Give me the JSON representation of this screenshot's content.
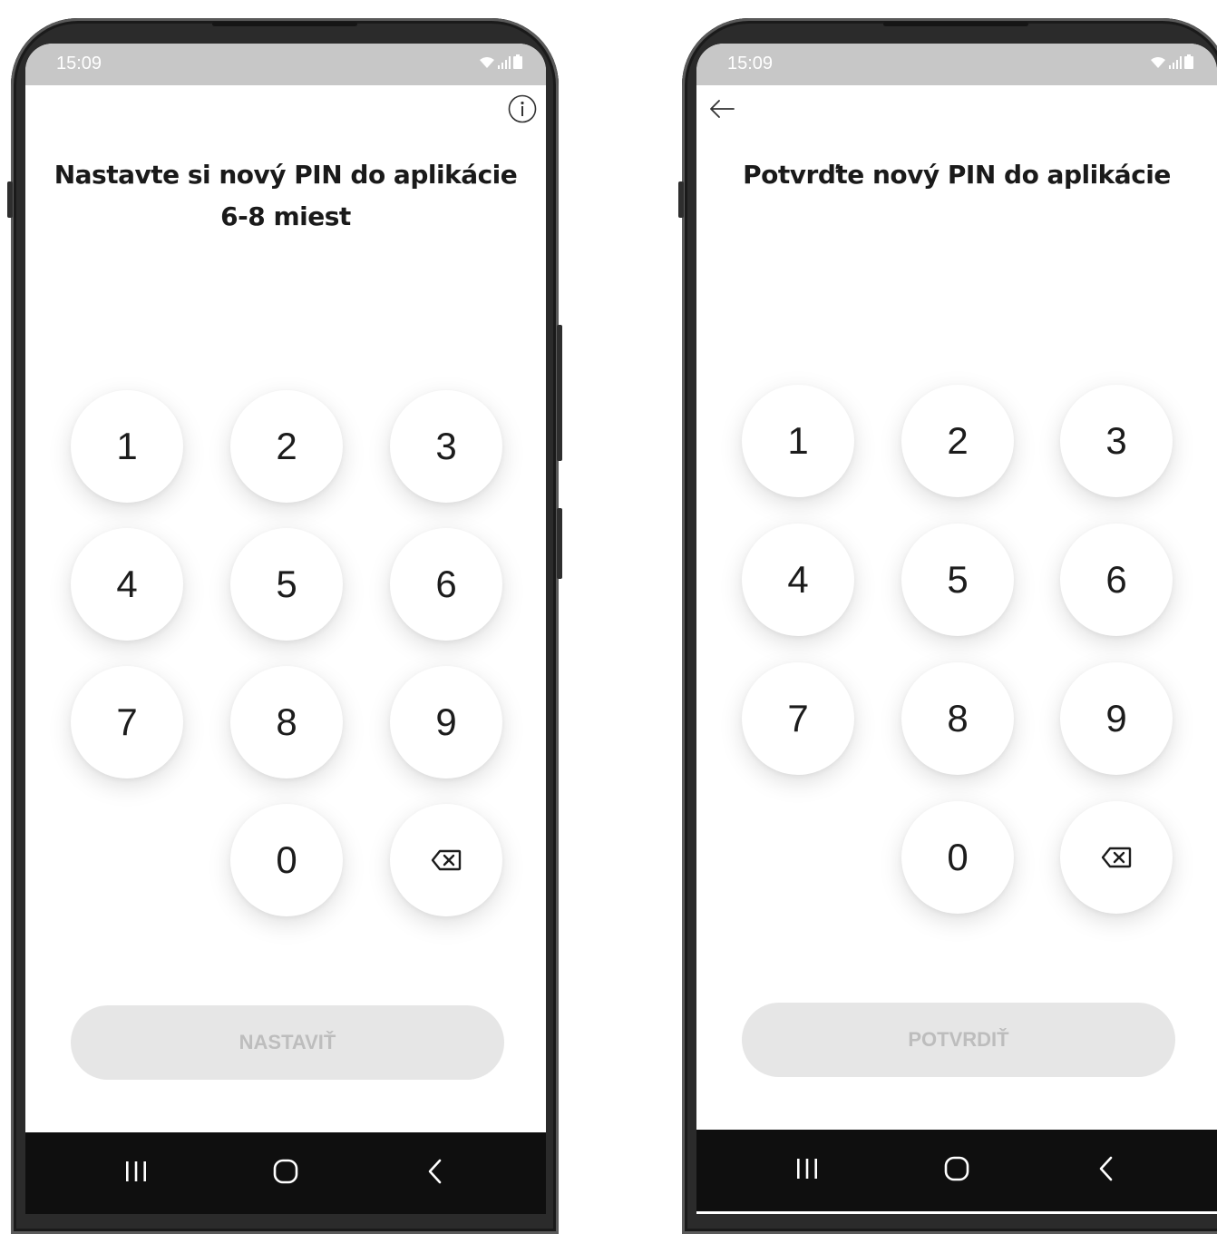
{
  "screens": [
    {
      "status_time": "15:09",
      "title_line1": "Nastavte si nový PIN do aplikácie",
      "title_line2": "6-8 miest",
      "top_icon": "info-icon",
      "keys": [
        "1",
        "2",
        "3",
        "4",
        "5",
        "6",
        "7",
        "8",
        "9",
        "0"
      ],
      "delete_icon": "backspace-icon",
      "button_label": "NASTAVIŤ"
    },
    {
      "status_time": "15:09",
      "title_line1": "Potvrďte nový PIN do aplikácie",
      "title_line2": "",
      "top_icon": "back-arrow-icon",
      "keys": [
        "1",
        "2",
        "3",
        "4",
        "5",
        "6",
        "7",
        "8",
        "9",
        "0"
      ],
      "delete_icon": "backspace-icon",
      "button_label": "POTVRDIŤ"
    }
  ],
  "nav": [
    "recents-icon",
    "home-icon",
    "back-icon"
  ],
  "colors": {
    "status_bar": "#c7c7c7",
    "nav_bar": "#0f0f0f",
    "button_disabled_bg": "#e6e6e6",
    "button_disabled_text": "#bdbdbd"
  }
}
